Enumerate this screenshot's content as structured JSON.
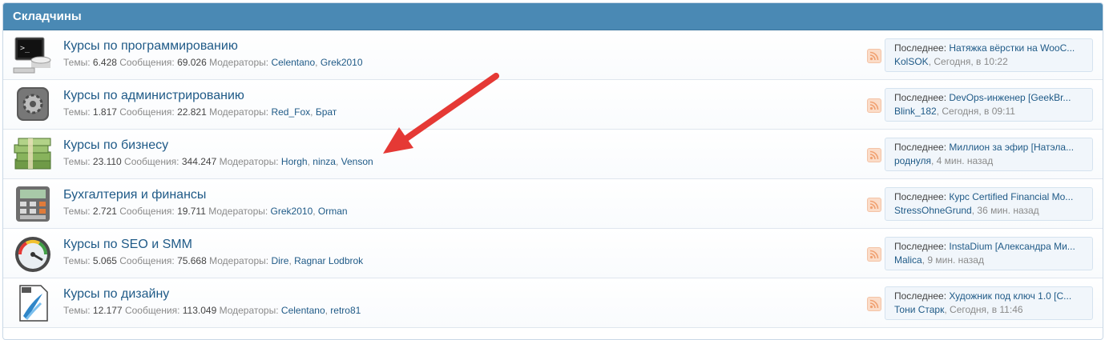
{
  "section": {
    "title": "Складчины"
  },
  "labels": {
    "threads": "Темы:",
    "messages": "Сообщения:",
    "moderators": "Модераторы:",
    "last": "Последнее:"
  },
  "forums": [
    {
      "title": "Курсы по программированию",
      "threads": "6.428",
      "messages": "69.026",
      "moderators": [
        "Celentano",
        "Grek2010"
      ],
      "last_title": "Натяжка вёрстки на WooC...",
      "last_user": "KolSOK",
      "last_time": "Сегодня, в 10:22",
      "icon": "terminal-icon"
    },
    {
      "title": "Курсы по администрированию",
      "threads": "1.817",
      "messages": "22.821",
      "moderators": [
        "Red_Fox",
        "Брат"
      ],
      "last_title": "DevOps-инженер [GeekBr...",
      "last_user": "Blink_182",
      "last_time": "Сегодня, в 09:11",
      "icon": "gear-icon"
    },
    {
      "title": "Курсы по бизнесу",
      "threads": "23.110",
      "messages": "344.247",
      "moderators": [
        "Horgh",
        "ninza",
        "Venson"
      ],
      "last_title": "Миллион за эфир [Натэла...",
      "last_user": "роднуля",
      "last_time": "4 мин. назад",
      "icon": "money-icon"
    },
    {
      "title": "Бухгалтерия и финансы",
      "threads": "2.721",
      "messages": "19.711",
      "moderators": [
        "Grek2010",
        "Orman"
      ],
      "last_title": "Курс Certified Financial Mo...",
      "last_user": "StressOhneGrund",
      "last_time": "36 мин. назад",
      "icon": "calculator-icon"
    },
    {
      "title": "Курсы по SEO и SMM",
      "threads": "5.065",
      "messages": "75.668",
      "moderators": [
        "Dire",
        "Ragnar Lodbrok"
      ],
      "last_title": "InstaDium [Александра Ми...",
      "last_user": "Malica",
      "last_time": "9 мин. назад",
      "icon": "gauge-icon"
    },
    {
      "title": "Курсы по дизайну",
      "threads": "12.177",
      "messages": "113.049",
      "moderators": [
        "Celentano",
        "retro81"
      ],
      "last_title": "Художник под ключ 1.0 [С...",
      "last_user": "Тони Старк",
      "last_time": "Сегодня, в 11:46",
      "icon": "design-file-icon"
    }
  ],
  "colors": {
    "header": "#4a89b4",
    "link": "#1f5a87",
    "arrow": "#e53935"
  }
}
